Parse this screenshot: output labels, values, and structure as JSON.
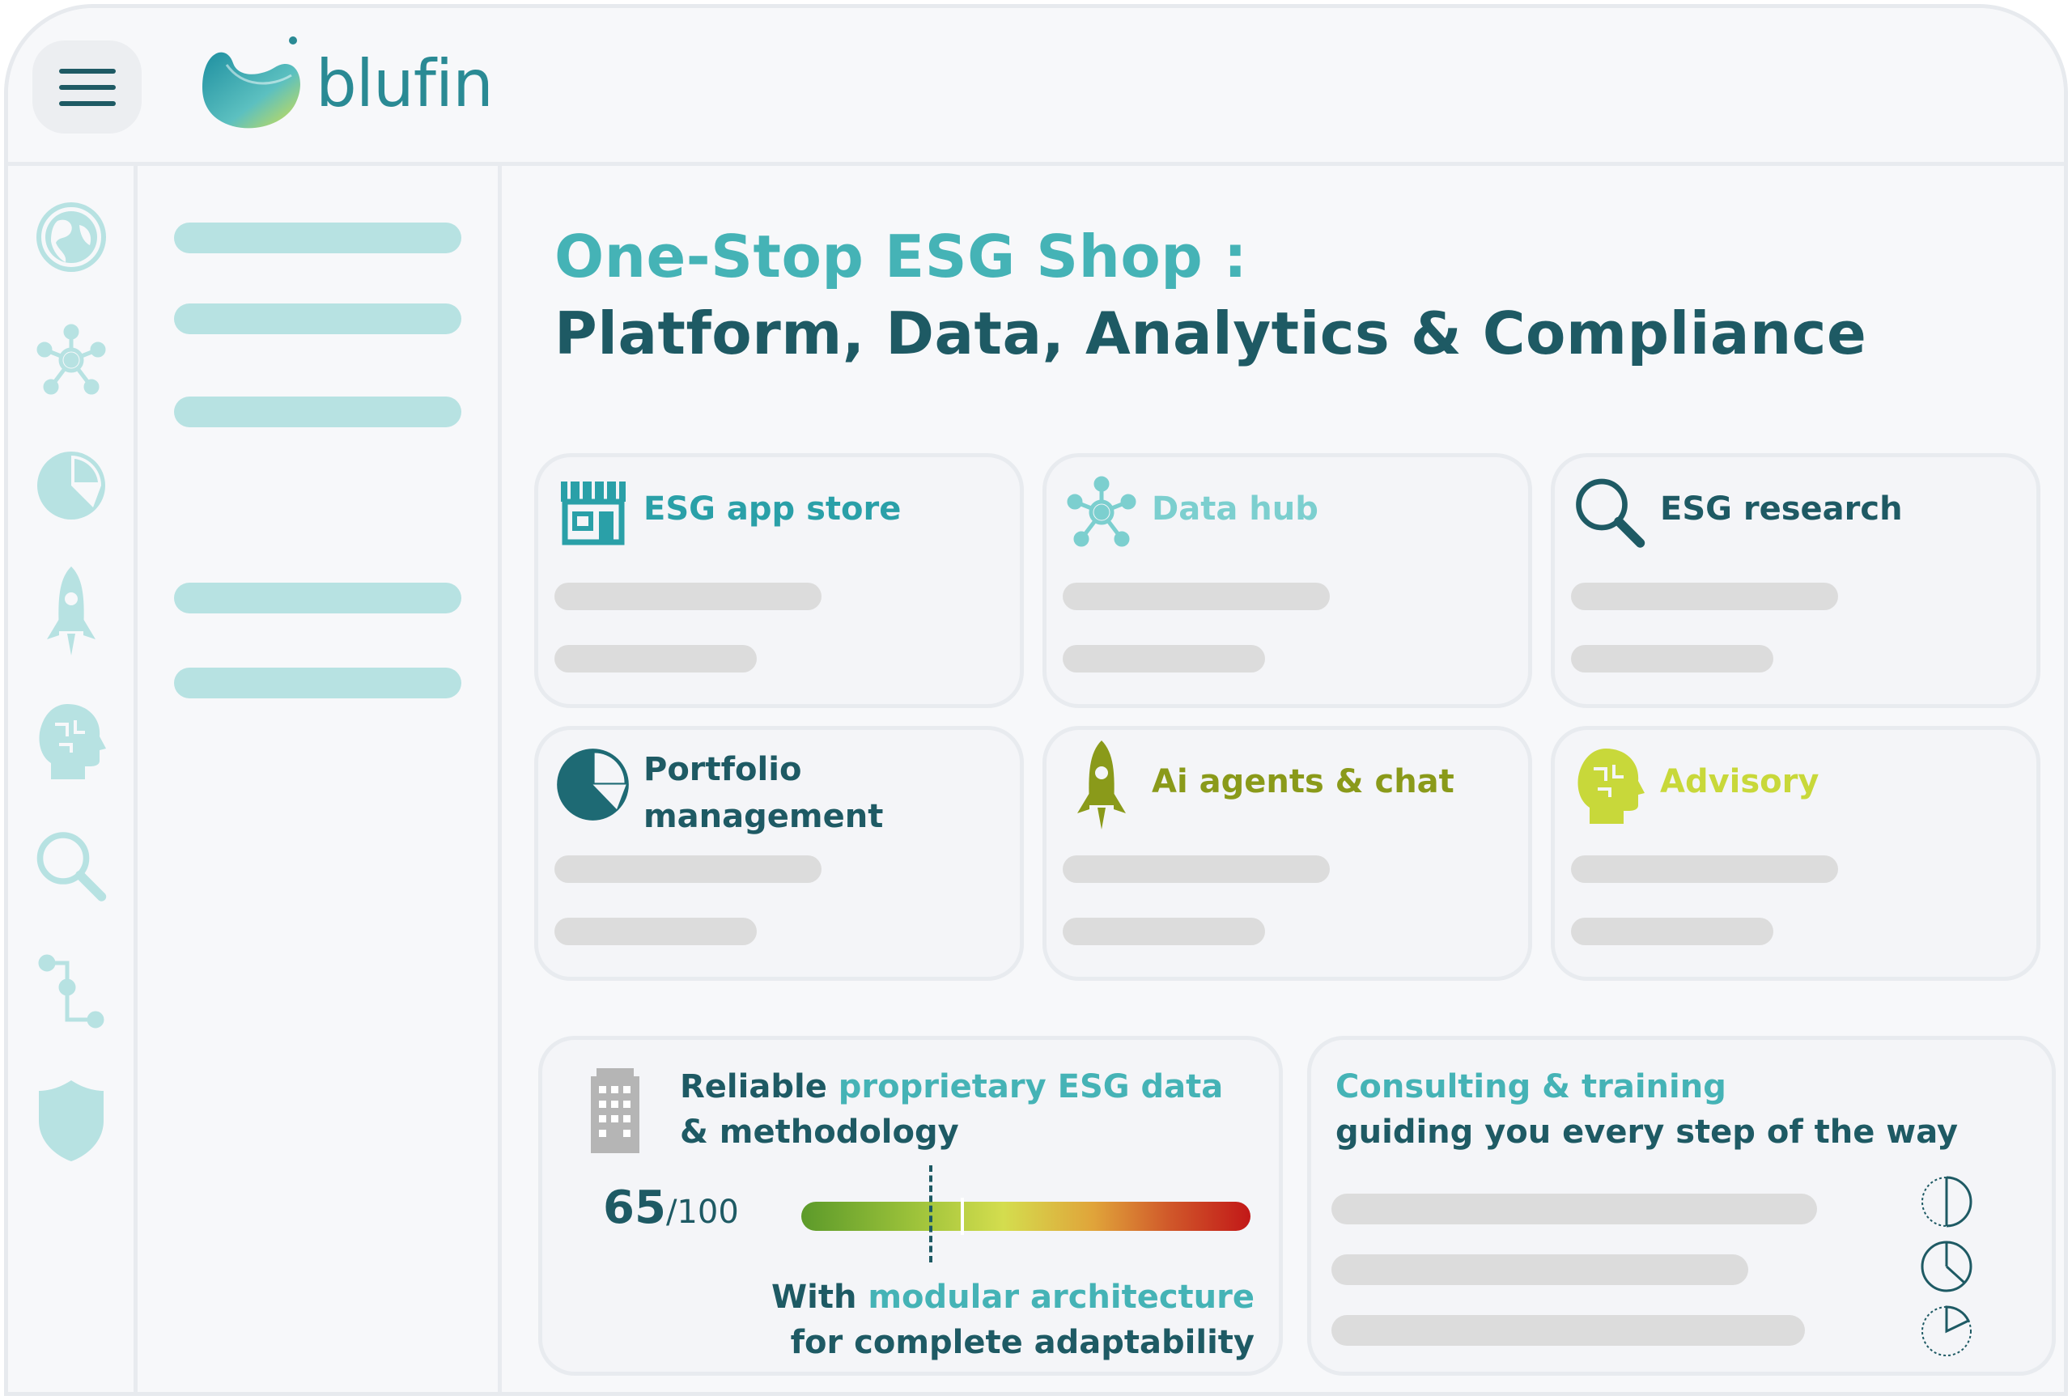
{
  "brand": {
    "name": "blufin",
    "colors": {
      "teal": "#45b3b6",
      "dark": "#1e5a64",
      "olive": "#8a9a1a",
      "lime": "#c8d83a",
      "soft": "#b7e2e2"
    }
  },
  "topbar": {
    "menu_icon": "hamburger-icon"
  },
  "rail": {
    "icons": [
      "globe-icon",
      "network-icon",
      "pie-chart-icon",
      "rocket-icon",
      "brain-head-icon",
      "search-icon",
      "flow-icon",
      "shield-icon"
    ]
  },
  "heading": {
    "line1": "One-Stop ESG Shop :",
    "line2": "Platform, Data, Analytics & Compliance"
  },
  "cards": [
    {
      "title": "ESG app store",
      "icon": "store-icon",
      "color": "#2aa0a8"
    },
    {
      "title": "Data hub",
      "icon": "network-icon",
      "color": "#7ccfcf"
    },
    {
      "title": "ESG research",
      "icon": "search-icon",
      "color": "#1e5a64"
    },
    {
      "title_line1": "Portfolio",
      "title_line2": "management",
      "icon": "pie-chart-icon",
      "color": "#1e5a64"
    },
    {
      "title": "Ai agents & chat",
      "icon": "rocket-icon",
      "color": "#8a9a1a"
    },
    {
      "title": "Advisory",
      "icon": "brain-head-icon",
      "color": "#c8d83a"
    }
  ],
  "esg_data_panel": {
    "icon": "building-icon",
    "title_part1": "Reliable ",
    "title_part2": "proprietary ESG data",
    "title_line2": "& methodology",
    "score_value": "65",
    "score_max": "/100",
    "score_fraction": 0.65,
    "footer_part1": "With ",
    "footer_part2": "modular architecture",
    "footer_line2": "for complete adaptability"
  },
  "consulting_panel": {
    "title_line1": "Consulting & training",
    "title_line2": "guiding you every step of the way",
    "timer_icons": [
      "half-timer-icon",
      "quarter-timer-icon",
      "eighth-timer-icon"
    ]
  }
}
